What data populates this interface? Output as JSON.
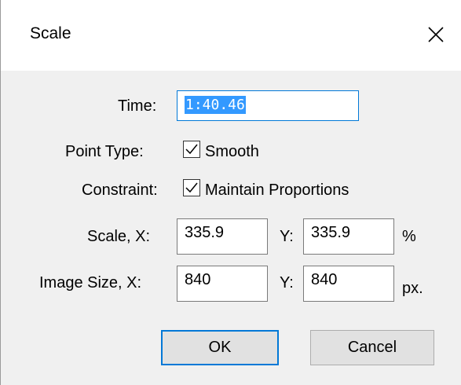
{
  "window": {
    "title": "Scale"
  },
  "fields": {
    "time_label": "Time:",
    "time_value": "1:40.46",
    "point_type_label": "Point Type:",
    "smooth_label": "Smooth",
    "smooth_checked": true,
    "constraint_label": "Constraint:",
    "maintain_label": "Maintain Proportions",
    "maintain_checked": true,
    "scale_label": "Scale, X:",
    "scale_x": "335.9",
    "scale_y_label": "Y:",
    "scale_y": "335.9",
    "scale_unit": "%",
    "size_label": "Image Size, X:",
    "size_x": "840",
    "size_y_label": "Y:",
    "size_y": "840",
    "size_unit": "px."
  },
  "buttons": {
    "ok": "OK",
    "cancel": "Cancel"
  },
  "icons": {
    "close": "close-icon",
    "check": "check-icon"
  },
  "colors": {
    "accent": "#0078d7",
    "selection": "#3399ff",
    "background": "#f0f0f0"
  }
}
